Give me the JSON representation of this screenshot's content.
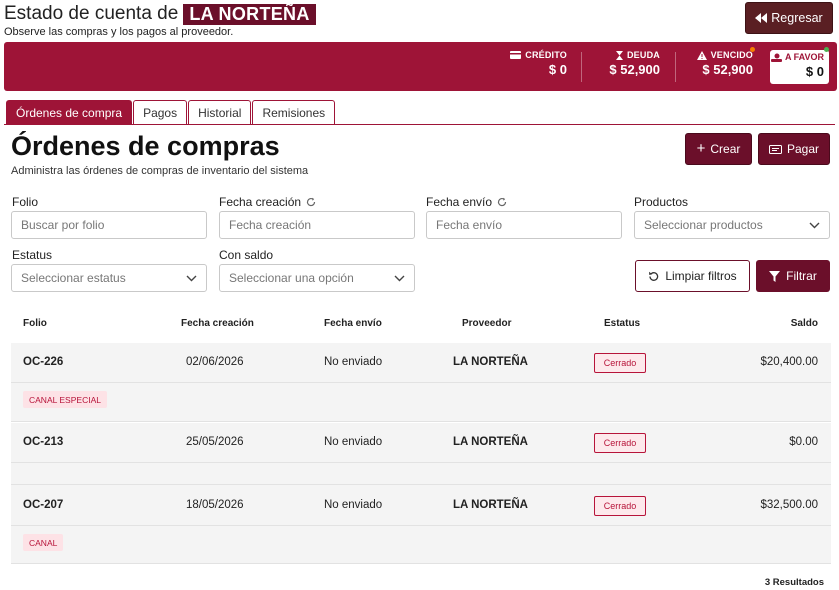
{
  "header": {
    "title_prefix": "Estado de cuenta de",
    "supplier": "LA NORTEÑA",
    "subtitle": "Observe las compras y los pagos al proveedor.",
    "back_label": "Regresar"
  },
  "summary": {
    "credito": {
      "label": "CRÉDITO",
      "value": "$ 0"
    },
    "deuda": {
      "label": "DEUDA",
      "value": "$ 52,900"
    },
    "vencido": {
      "label": "VENCIDO",
      "value": "$ 52,900"
    },
    "favor": {
      "label": "A FAVOR",
      "value": "$ 0"
    }
  },
  "tabs": [
    {
      "label": "Órdenes de compra",
      "active": true
    },
    {
      "label": "Pagos",
      "active": false
    },
    {
      "label": "Historial",
      "active": false
    },
    {
      "label": "Remisiones",
      "active": false
    }
  ],
  "section": {
    "title": "Órdenes de compras",
    "subtitle": "Administra las órdenes de compras de inventario del sistema",
    "create_label": "Crear",
    "pay_label": "Pagar"
  },
  "filters": {
    "folio": {
      "label": "Folio",
      "placeholder": "Buscar por folio"
    },
    "fecha_creacion": {
      "label": "Fecha creación",
      "placeholder": "Fecha creación"
    },
    "fecha_envio": {
      "label": "Fecha envío",
      "placeholder": "Fecha envío"
    },
    "productos": {
      "label": "Productos",
      "placeholder": "Seleccionar productos"
    },
    "estatus": {
      "label": "Estatus",
      "placeholder": "Seleccionar estatus"
    },
    "con_saldo": {
      "label": "Con saldo",
      "placeholder": "Seleccionar una opción"
    },
    "clear_label": "Limpiar filtros",
    "filter_label": "Filtrar"
  },
  "table": {
    "columns": [
      "Folio",
      "Fecha creación",
      "Fecha envío",
      "Proveedor",
      "Estatus",
      "Saldo"
    ],
    "rows": [
      {
        "folio": "OC-226",
        "fecha_creacion": "02/06/2026",
        "fecha_envio": "No enviado",
        "proveedor": "LA NORTEÑA",
        "estatus": "Cerrado",
        "saldo": "$20,400.00",
        "tag": "CANAL ESPECIAL"
      },
      {
        "folio": "OC-213",
        "fecha_creacion": "25/05/2026",
        "fecha_envio": "No enviado",
        "proveedor": "LA NORTEÑA",
        "estatus": "Cerrado",
        "saldo": "$0.00",
        "tag": ""
      },
      {
        "folio": "OC-207",
        "fecha_creacion": "18/05/2026",
        "fecha_envio": "No enviado",
        "proveedor": "LA NORTEÑA",
        "estatus": "Cerrado",
        "saldo": "$32,500.00",
        "tag": "CANAL"
      }
    ],
    "results": "3 Resultados"
  },
  "colors": {
    "brand": "#9e1437",
    "brand_dark": "#6b0f2a",
    "back_button": "#5a1f23",
    "indicator_green": "#4caf50",
    "indicator_orange": "#f57c00"
  }
}
